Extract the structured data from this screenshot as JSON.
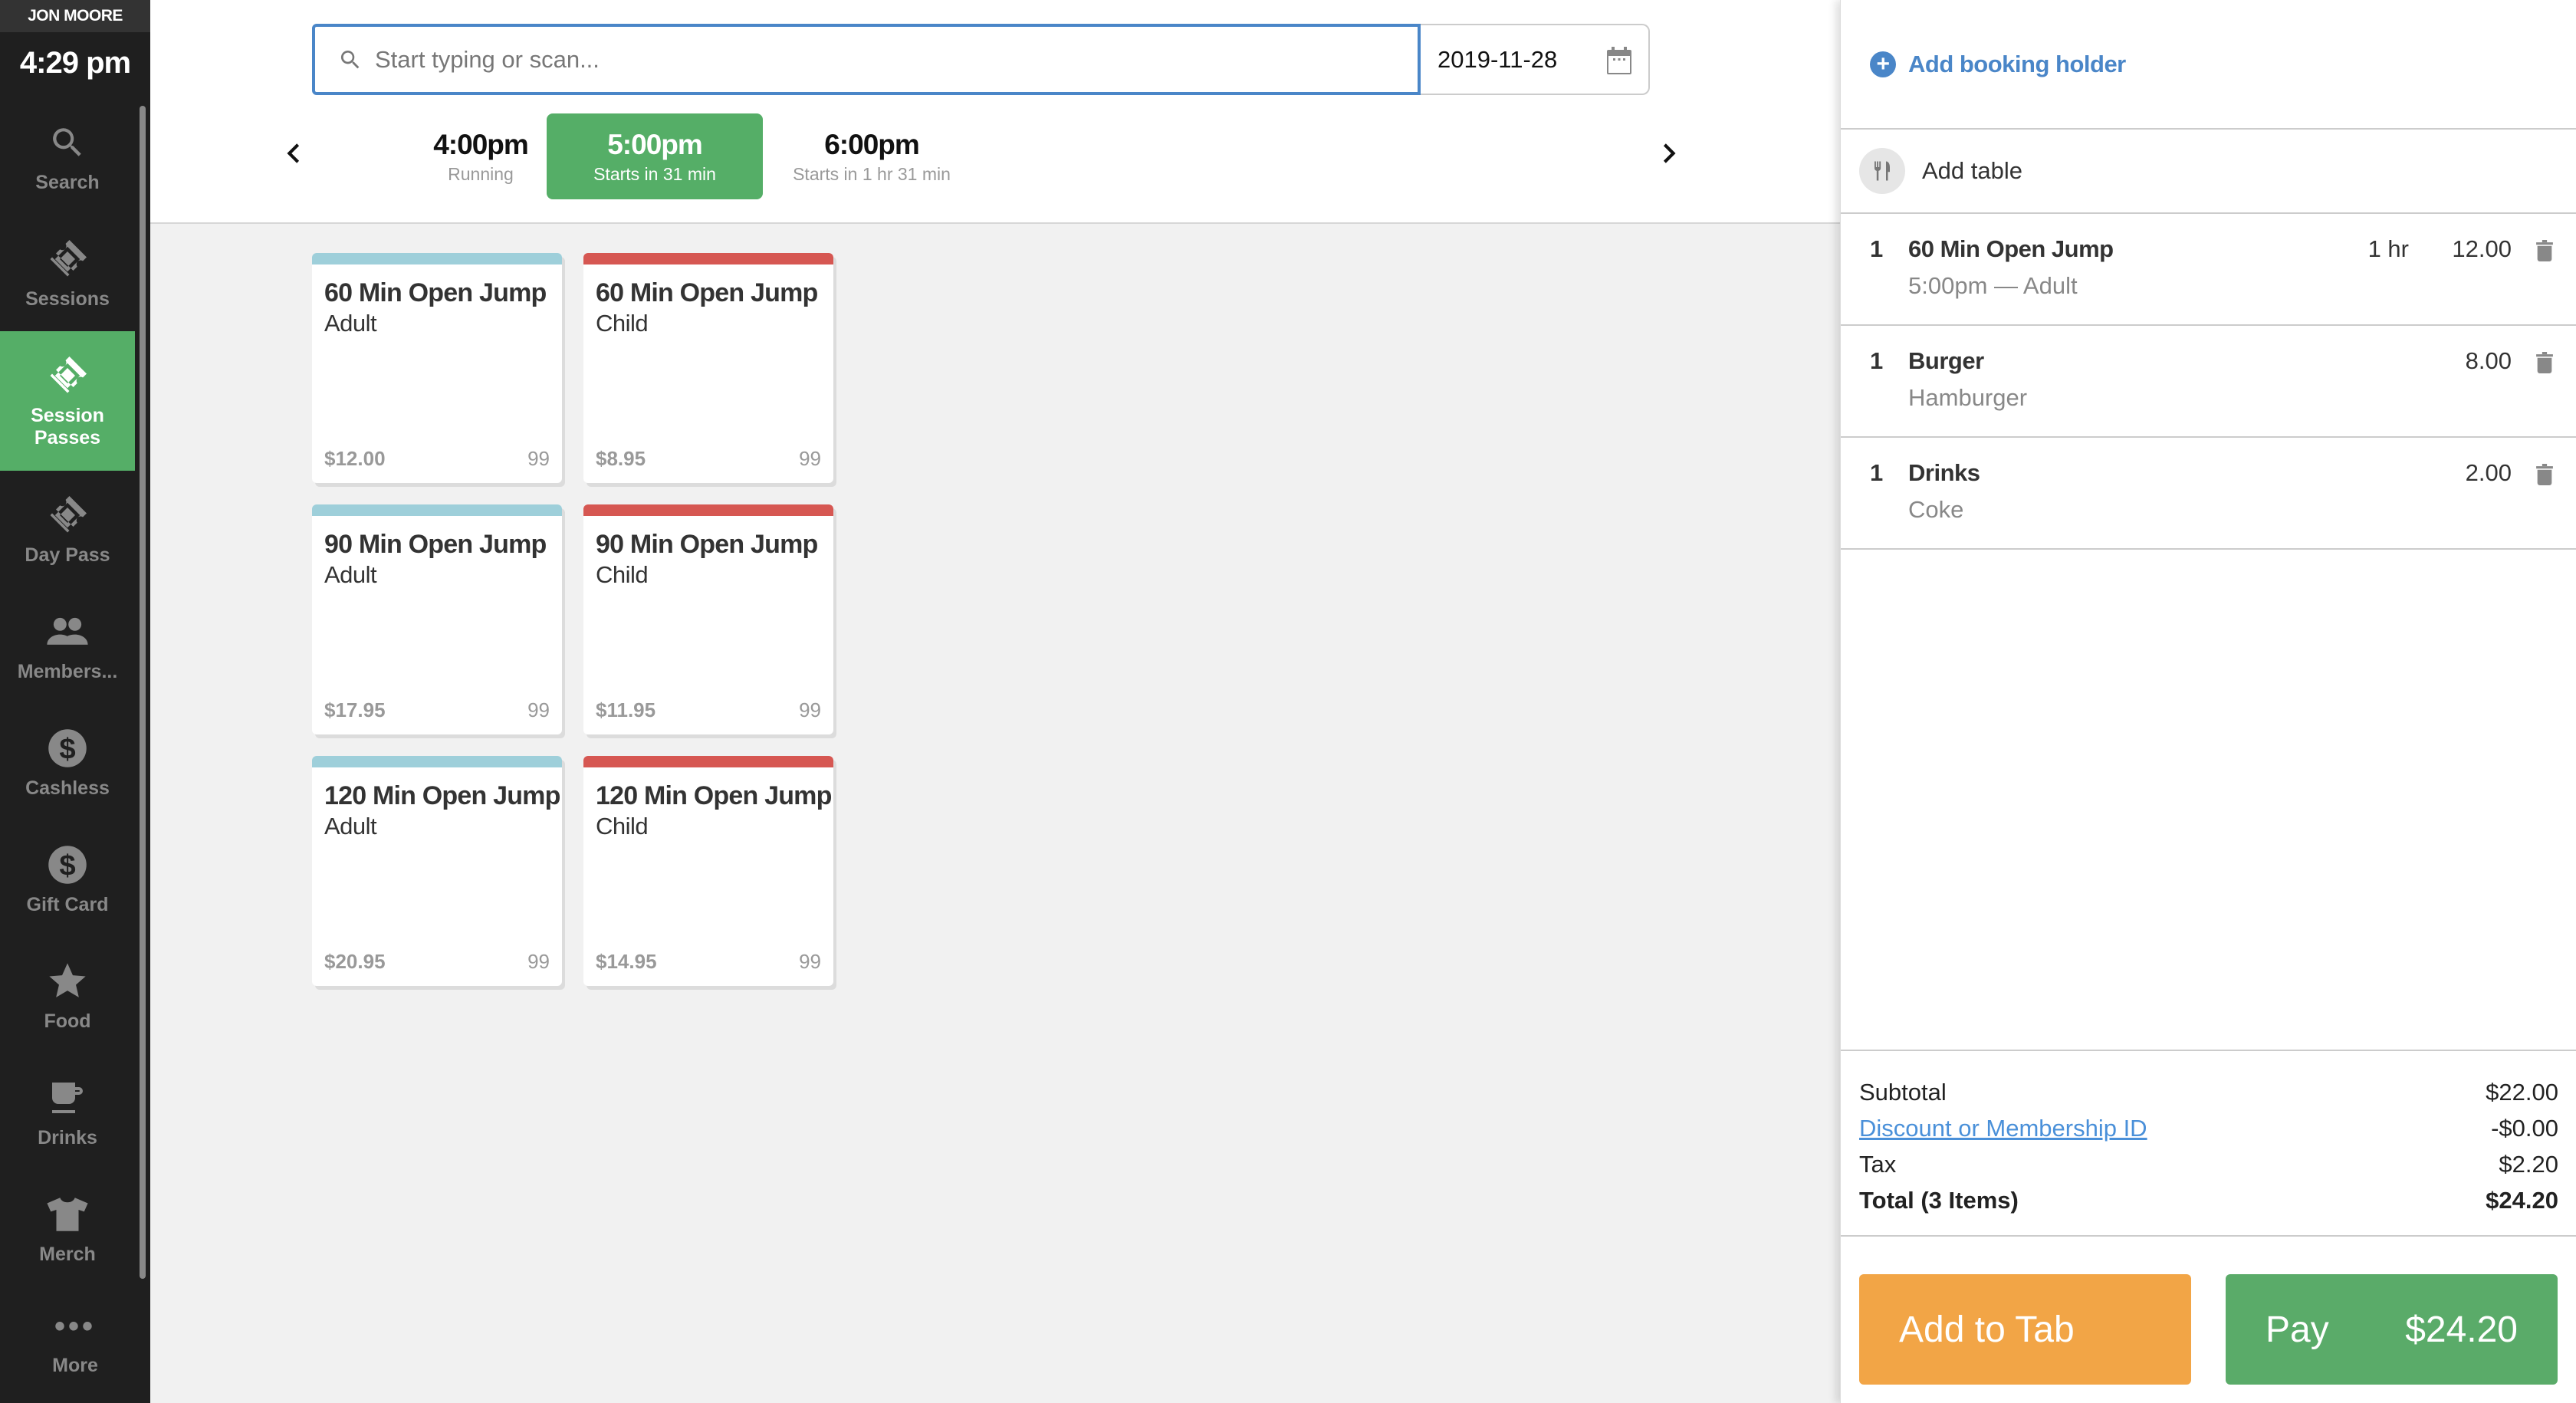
{
  "sidebar": {
    "user": "JON MOORE",
    "time": "4:29 pm",
    "items": [
      {
        "label": "Search",
        "icon": "search-icon"
      },
      {
        "label": "Sessions",
        "icon": "ticket-icon"
      },
      {
        "label": "Session Passes",
        "icon": "ticket-icon",
        "active": true
      },
      {
        "label": "Day Pass",
        "icon": "ticket-icon"
      },
      {
        "label": "Members...",
        "icon": "people-icon"
      },
      {
        "label": "Cashless",
        "icon": "dollar-circle-icon"
      },
      {
        "label": "Gift Card",
        "icon": "dollar-circle-icon"
      },
      {
        "label": "Food",
        "icon": "star-icon"
      },
      {
        "label": "Drinks",
        "icon": "cup-icon"
      },
      {
        "label": "Merch",
        "icon": "tshirt-icon"
      }
    ],
    "more_label": "More"
  },
  "search": {
    "placeholder": "Start typing or scan...",
    "value": ""
  },
  "date": "2019-11-28",
  "time_slots": [
    {
      "time": "4:00pm",
      "status": "Running"
    },
    {
      "time": "5:00pm",
      "status": "Starts in 31 min",
      "active": true
    },
    {
      "time": "6:00pm",
      "status": "Starts in 1 hr 31 min"
    }
  ],
  "colors": {
    "accent_green": "#55ae67",
    "link_blue": "#4a86c8",
    "adult_bar": "#9ecfda",
    "child_bar": "#d65752",
    "add_to_tab": "#f2a546",
    "pay": "#5aab69"
  },
  "cards": [
    {
      "name": "60 Min Open Jump",
      "type": "Adult",
      "price": "$12.00",
      "stock": "99",
      "category": "adult"
    },
    {
      "name": "60 Min Open Jump",
      "type": "Child",
      "price": "$8.95",
      "stock": "99",
      "category": "child"
    },
    {
      "name": "90 Min Open Jump",
      "type": "Adult",
      "price": "$17.95",
      "stock": "99",
      "category": "adult"
    },
    {
      "name": "90 Min Open Jump",
      "type": "Child",
      "price": "$11.95",
      "stock": "99",
      "category": "child"
    },
    {
      "name": "120 Min Open Jump",
      "type": "Adult",
      "price": "$20.95",
      "stock": "99",
      "category": "adult"
    },
    {
      "name": "120 Min Open Jump",
      "type": "Child",
      "price": "$14.95",
      "stock": "99",
      "category": "child"
    }
  ],
  "panel": {
    "add_booking_holder": "Add booking holder",
    "add_table": "Add table",
    "line_items": [
      {
        "qty": "1",
        "name": "60 Min Open Jump",
        "desc": "5:00pm — Adult",
        "duration": "1 hr",
        "amount": "12.00"
      },
      {
        "qty": "1",
        "name": "Burger",
        "desc": "Hamburger",
        "duration": "",
        "amount": "8.00"
      },
      {
        "qty": "1",
        "name": "Drinks",
        "desc": "Coke",
        "duration": "",
        "amount": "2.00"
      }
    ],
    "totals": {
      "subtotal_label": "Subtotal",
      "subtotal": "$22.00",
      "discount_label": "Discount or Membership ID",
      "discount": "-$0.00",
      "tax_label": "Tax",
      "tax": "$2.20",
      "total_label": "Total (3 Items)",
      "total": "$24.20"
    },
    "add_to_tab_label": "Add to Tab",
    "pay_label": "Pay",
    "pay_amount": "$24.20"
  }
}
